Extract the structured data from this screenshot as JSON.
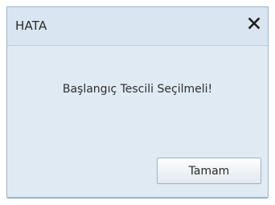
{
  "dialog": {
    "title": "HATA",
    "message": "Başlangıç Tescili Seçilmeli!",
    "ok_label": "Tamam",
    "close_icon": "close-icon"
  },
  "colors": {
    "titlebar_bg": "#d9e6f1",
    "content_bg": "#dfeaf3",
    "border": "#9fb5c9",
    "text": "#2b2b2b"
  }
}
